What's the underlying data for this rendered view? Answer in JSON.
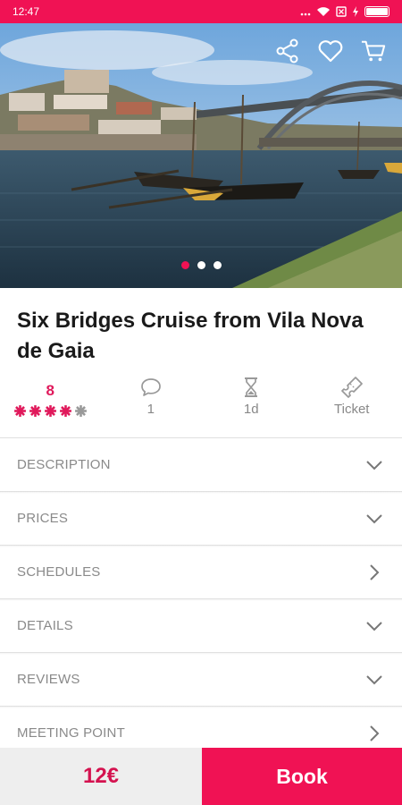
{
  "status_bar": {
    "time": "12:47"
  },
  "hero": {
    "actions": [
      "share-icon",
      "heart-icon",
      "cart-icon"
    ],
    "dots": [
      true,
      false,
      false
    ]
  },
  "title": "Six Bridges Cruise from Vila Nova de Gaia",
  "stats": {
    "rating": "8",
    "stars_filled": 4,
    "stars_total": 5,
    "reviews_count": "1",
    "duration": "1d",
    "type": "Ticket"
  },
  "sections": [
    {
      "label": "DESCRIPTION",
      "chevron": "down"
    },
    {
      "label": "PRICES",
      "chevron": "down"
    },
    {
      "label": "SCHEDULES",
      "chevron": "right"
    },
    {
      "label": "DETAILS",
      "chevron": "down"
    },
    {
      "label": "REVIEWS",
      "chevron": "down"
    },
    {
      "label": "MEETING POINT",
      "chevron": "right"
    }
  ],
  "bottom": {
    "price": "12€",
    "book_label": "Book"
  },
  "colors": {
    "accent": "#f01254",
    "star_filled": "#e0195b",
    "star_empty": "#999999"
  }
}
